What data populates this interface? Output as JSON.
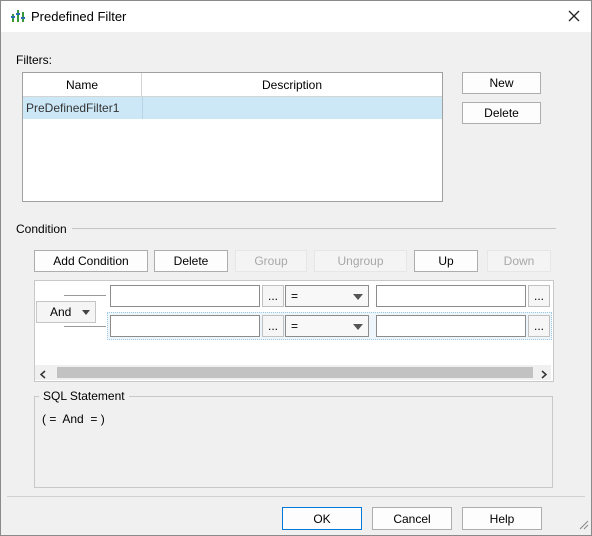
{
  "title": "Predefined Filter",
  "filters": {
    "label": "Filters:",
    "columns": [
      "Name",
      "Description"
    ],
    "rows": [
      {
        "name": "PreDefinedFilter1",
        "description": ""
      }
    ],
    "new_label": "New",
    "delete_label": "Delete"
  },
  "condition": {
    "label": "Condition",
    "toolbar": {
      "add_condition": "Add Condition",
      "delete": "Delete",
      "group": "Group",
      "ungroup": "Ungroup",
      "up": "Up",
      "down": "Down"
    },
    "logic_operator": "And",
    "rows": [
      {
        "left": "",
        "ellipsis1": "...",
        "operator": "=",
        "right": "",
        "ellipsis2": "..."
      },
      {
        "left": "",
        "ellipsis1": "...",
        "operator": "=",
        "right": "",
        "ellipsis2": "..."
      }
    ]
  },
  "sql": {
    "label": "SQL Statement",
    "text": "( =  And  = )"
  },
  "footer": {
    "ok": "OK",
    "cancel": "Cancel",
    "help": "Help"
  },
  "colors": {
    "selection": "#cce8f7",
    "default_button_border": "#0078d7",
    "icon_green": "#3a9a3a"
  },
  "icons": [
    "filter-app-icon",
    "close-icon",
    "chevron-down-icon",
    "scroll-left-icon",
    "scroll-right-icon",
    "resize-grip-icon"
  ]
}
